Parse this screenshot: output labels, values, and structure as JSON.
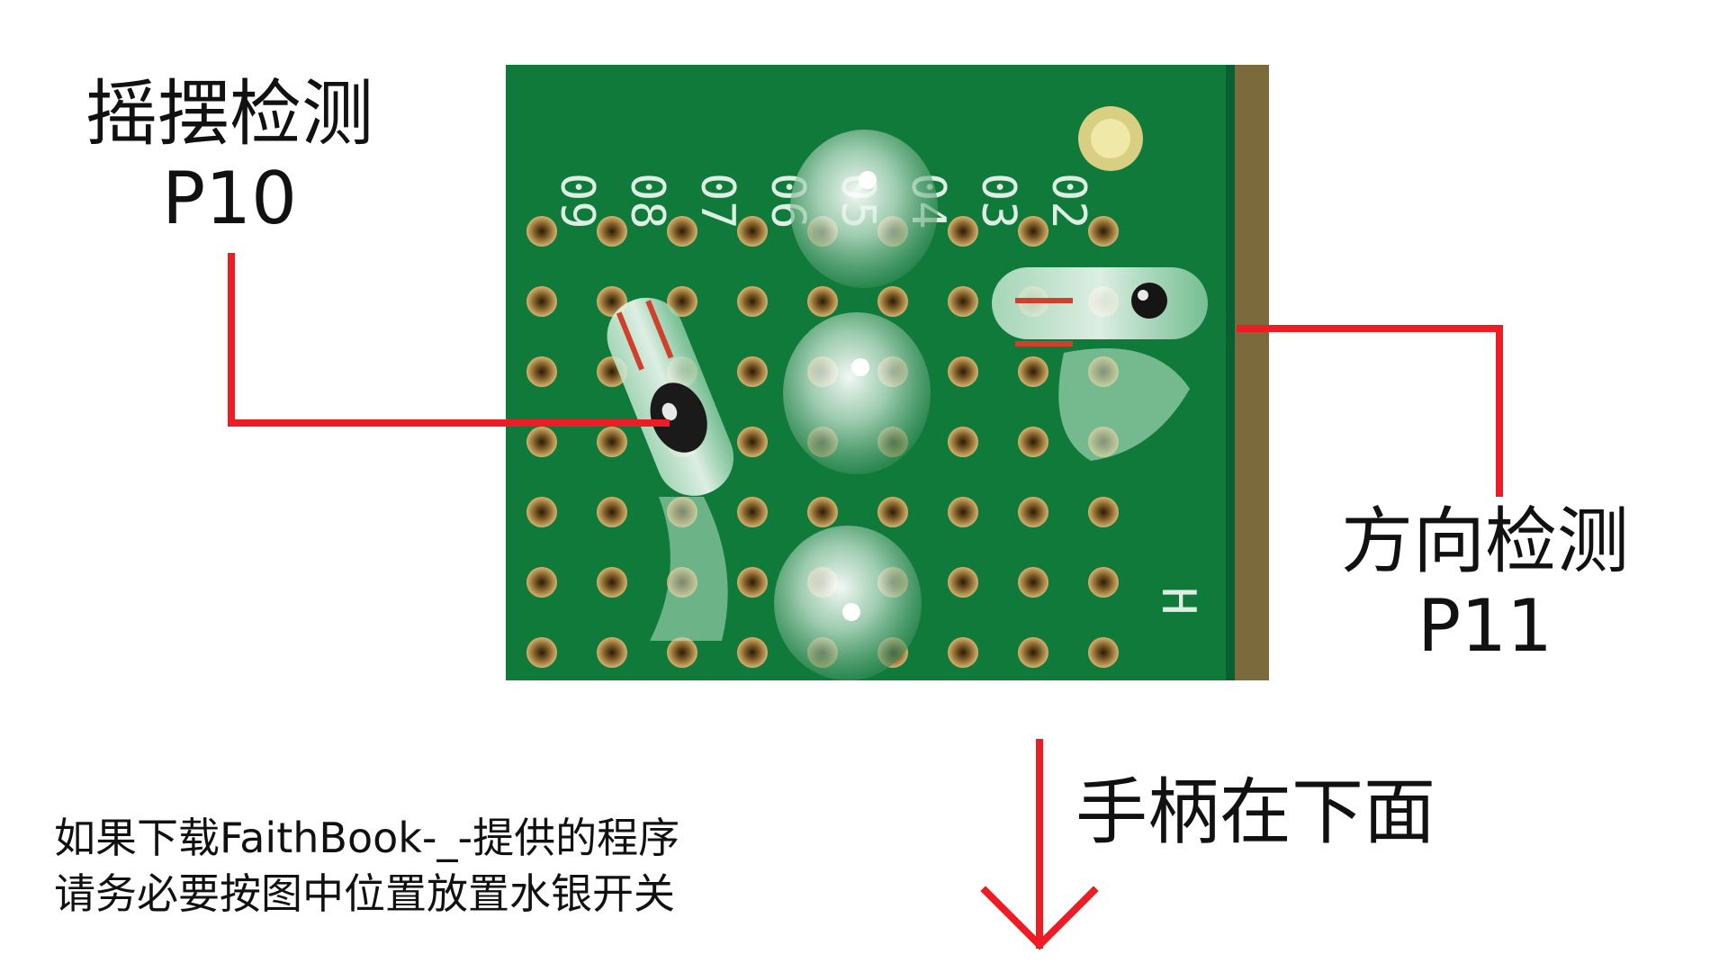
{
  "photo": {
    "board_silkscreen": [
      "09",
      "08",
      "07",
      "06",
      "05",
      "04",
      "03",
      "02"
    ],
    "board_marker": "H",
    "colors": {
      "pcb_green": "#0f7a3a",
      "pad_copper": "#c9a35a",
      "annotation_red": "#ee1c24"
    }
  },
  "labels": {
    "swing": {
      "line1": "摇摆检测",
      "line2": "P10"
    },
    "direction": {
      "line1": "方向检测",
      "line2": "P11"
    },
    "handle": "手柄在下面"
  },
  "note": {
    "line1": "如果下载FaithBook-_-提供的程序",
    "line2": "请务必要按图中位置放置水银开关"
  }
}
